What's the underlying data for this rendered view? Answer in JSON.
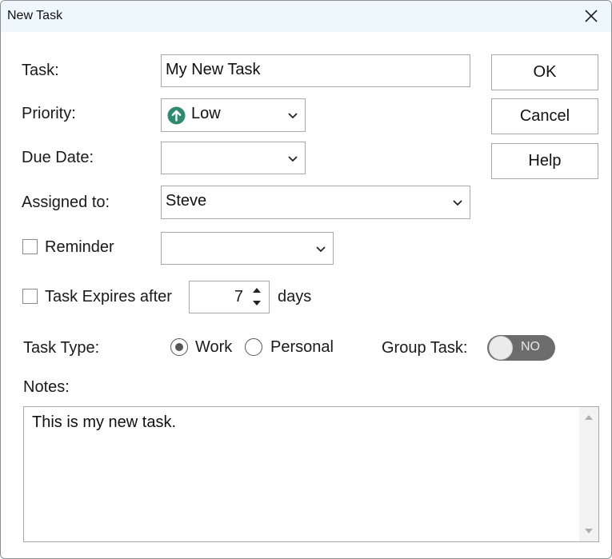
{
  "window": {
    "title": "New Task"
  },
  "form": {
    "task_label": "Task:",
    "task_value": "My New Task",
    "priority_label": "Priority:",
    "priority_value": "Low",
    "due_date_label": "Due Date:",
    "due_date_value": "",
    "assigned_label": "Assigned to:",
    "assigned_value": "Steve",
    "reminder_label": "Reminder",
    "reminder_checked": false,
    "reminder_value": "",
    "expires_label": "Task Expires after",
    "expires_checked": false,
    "expires_days": "7",
    "expires_unit": "days",
    "task_type_label": "Task Type:",
    "task_type_options": [
      "Work",
      "Personal"
    ],
    "task_type_selected": "Work",
    "group_task_label": "Group Task:",
    "group_task_state": "NO",
    "notes_label": "Notes:",
    "notes_value": "This is my new task."
  },
  "buttons": {
    "ok": "OK",
    "cancel": "Cancel",
    "help": "Help"
  },
  "colors": {
    "priority_icon": "#2e8b6e",
    "titlebar_bg": "#eef7fb",
    "toggle_bg": "#6c6c6c"
  },
  "icons": {
    "close": "close-icon",
    "priority": "arrow-up-circle-icon",
    "dropdown": "chevron-down-icon",
    "spin_up": "caret-up-icon",
    "spin_down": "caret-down-icon"
  }
}
